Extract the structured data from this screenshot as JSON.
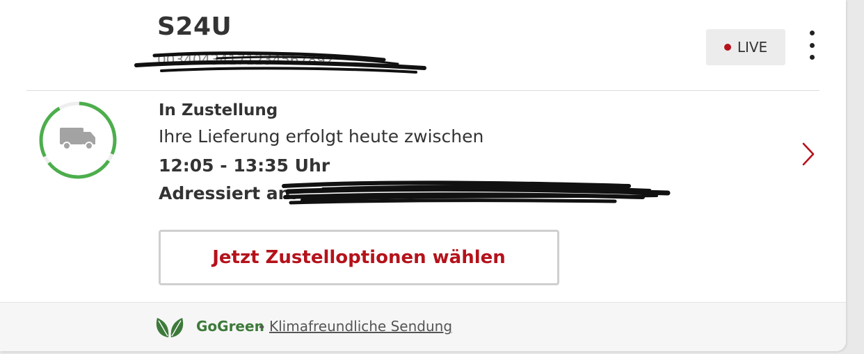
{
  "colors": {
    "accent_red": "#b5121b",
    "green": "#4cae4c",
    "dark_green": "#3d7a3a",
    "text": "#333333"
  },
  "shipment": {
    "title": "S24U",
    "tracking_number": "00340434171234567892",
    "live_label": "LIVE",
    "menu_icon": "kebab-menu-icon"
  },
  "status": {
    "heading": "In Zustellung",
    "message": "Ihre Lieferung erfolgt heute zwischen",
    "time_window": "12:05 - 13:35 Uhr",
    "address_label": "Adressiert an:",
    "progress_icon": "delivery-van-icon",
    "detail_icon": "chevron-right-icon"
  },
  "actions": {
    "delivery_options_label": "Jetzt Zustelloptionen wählen"
  },
  "footer": {
    "gogreen_label": "GoGreen",
    "separator": "-",
    "eco_text": "Klimafreundliche Sendung",
    "leaf_icon": "leaf-icon"
  }
}
